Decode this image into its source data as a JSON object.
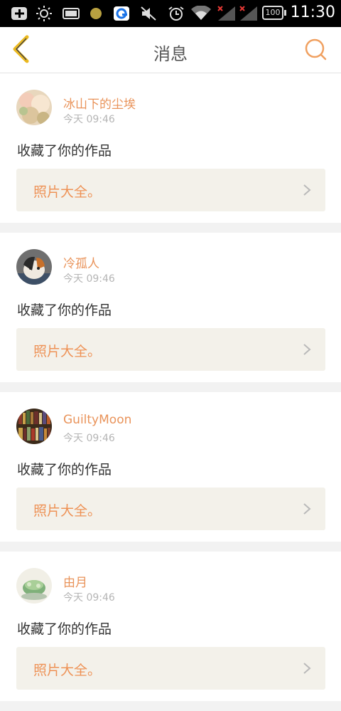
{
  "status_bar": {
    "time": "11:30",
    "battery": "100",
    "icons": [
      "notification-add-icon",
      "brightness-icon",
      "battery-saver-icon",
      "dot-icon",
      "app-icon",
      "mute-icon",
      "alarm-icon",
      "wifi-icon",
      "signal-no-service-icon",
      "signal-no-service-icon",
      "battery-icon"
    ]
  },
  "header": {
    "title": "消息",
    "back_icon": "chevron-left-icon",
    "search_icon": "search-icon",
    "accent_color": "#e9935a"
  },
  "messages": [
    {
      "user": "冰山下的尘埃",
      "time": "今天 09:46",
      "action": "收藏了你的作品",
      "work": "照片大全。"
    },
    {
      "user": "冷孤人",
      "time": "今天 09:46",
      "action": "收藏了你的作品",
      "work": "照片大全。"
    },
    {
      "user": "GuiltyMoon",
      "time": "今天 09:46",
      "action": "收藏了你的作品",
      "work": "照片大全。"
    },
    {
      "user": "由月",
      "time": "今天 09:46",
      "action": "收藏了你的作品",
      "work": "照片大全。"
    }
  ]
}
